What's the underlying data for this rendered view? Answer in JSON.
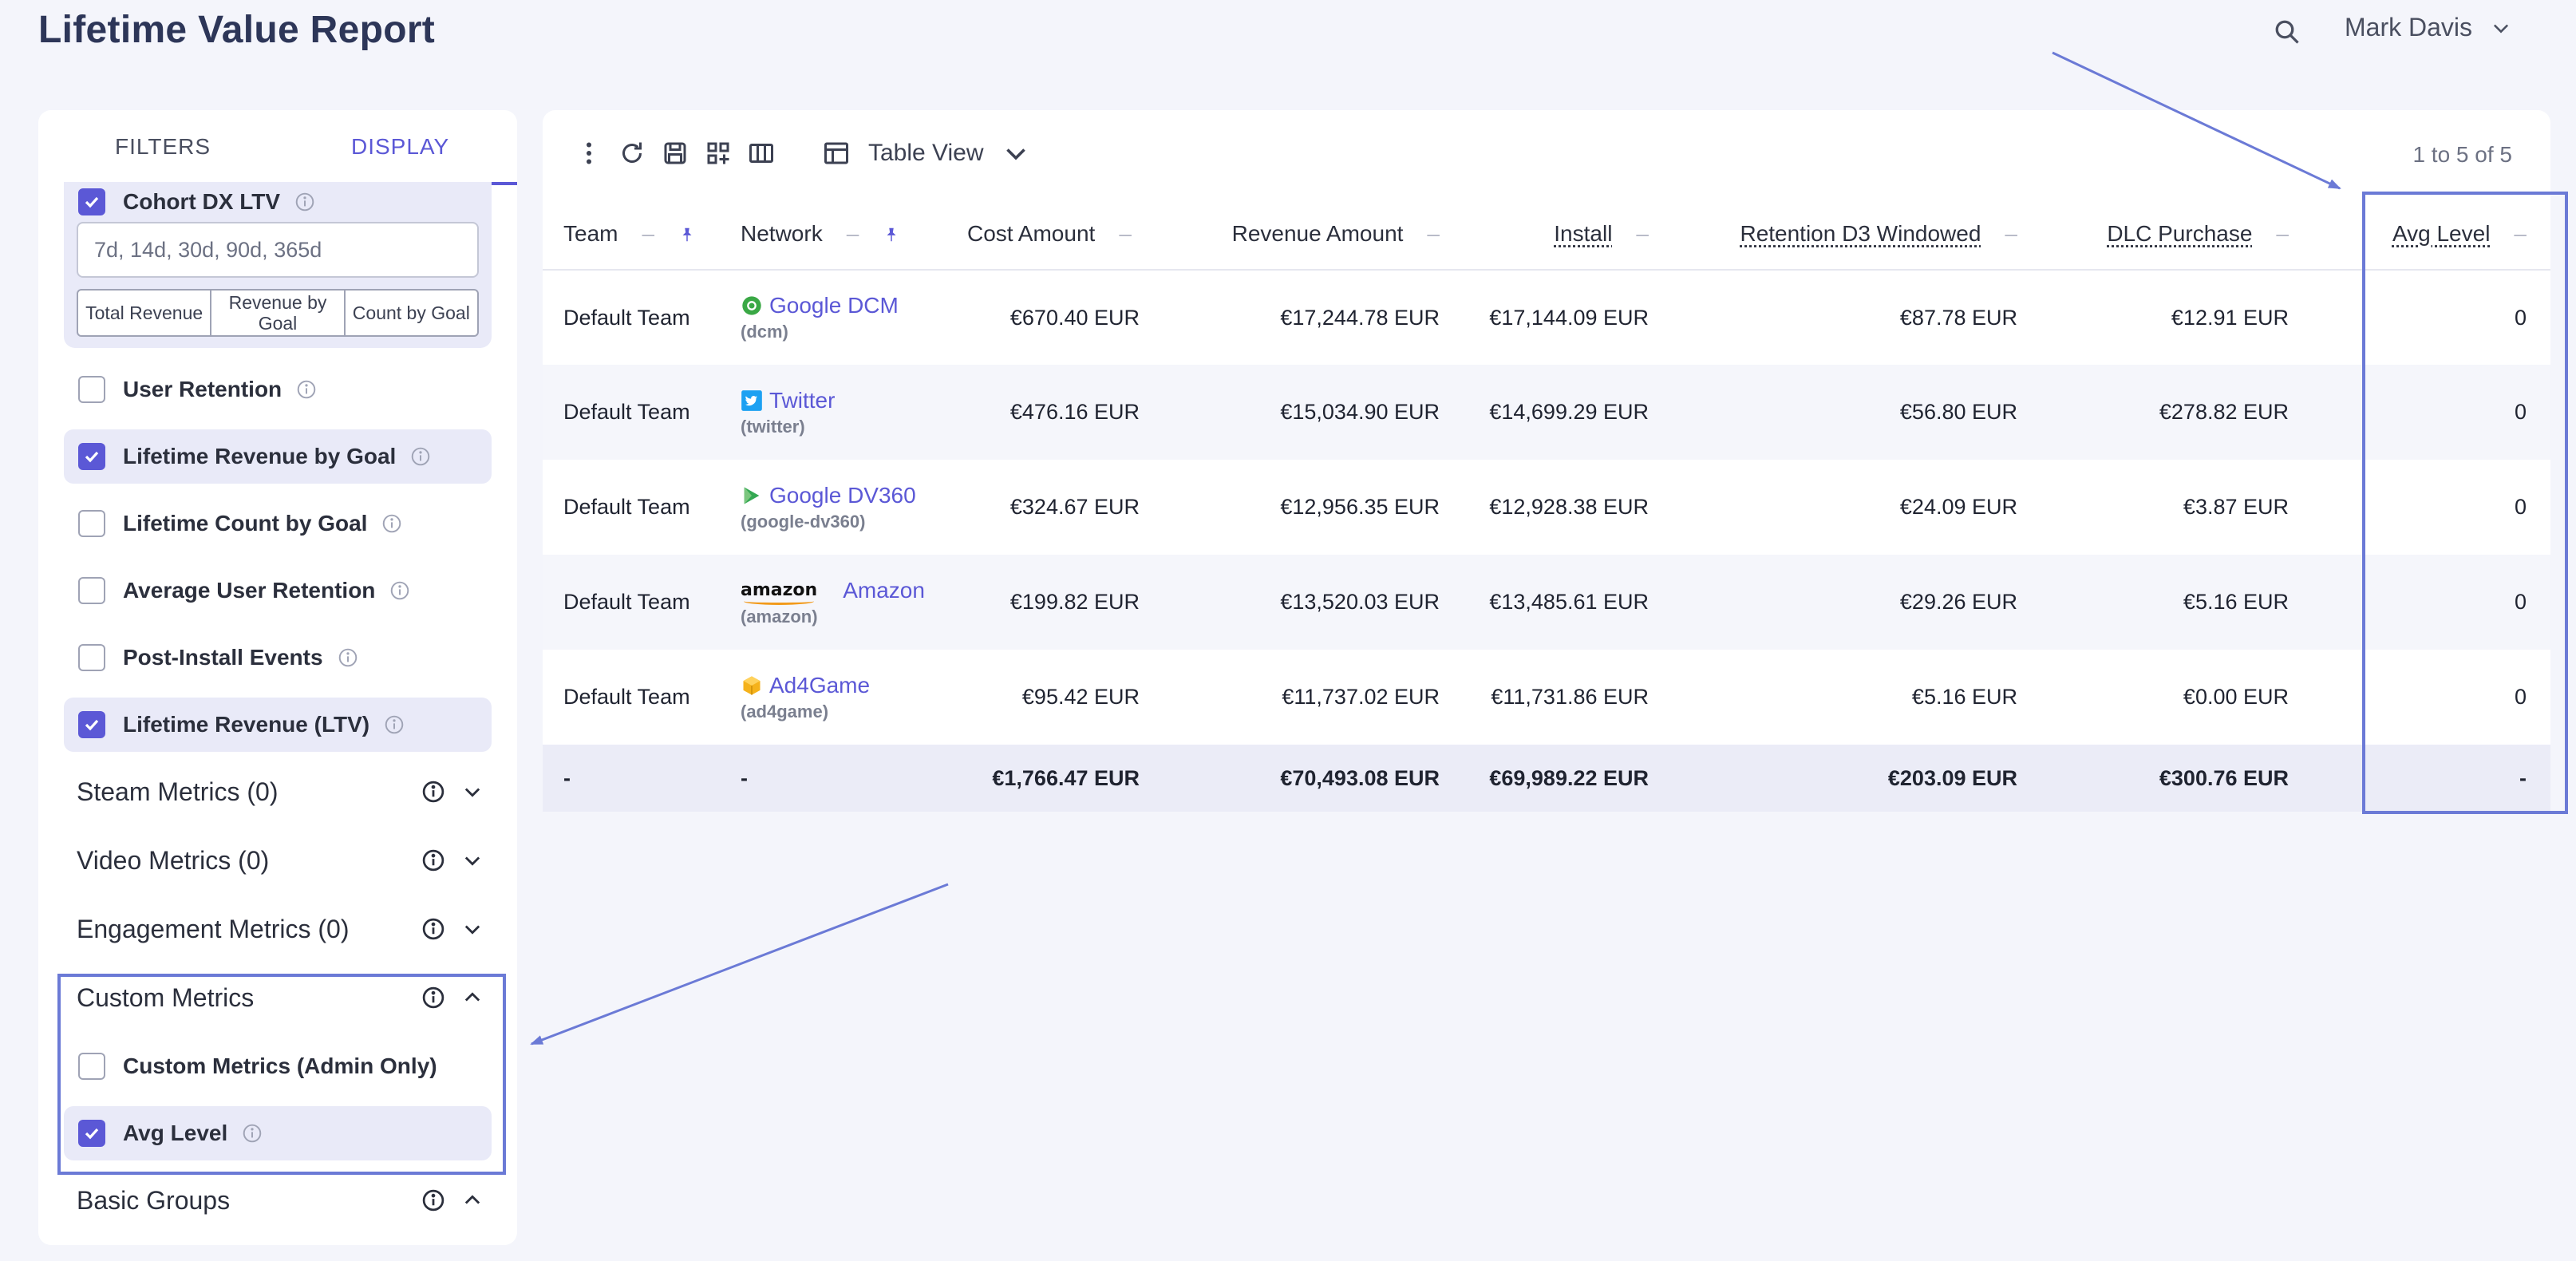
{
  "header": {
    "title": "Lifetime Value Report",
    "user_name": "Mark Davis"
  },
  "sidebar": {
    "tabs": {
      "filters": "FILTERS",
      "display": "DISPLAY"
    },
    "cohort": {
      "label": "Cohort DX LTV",
      "input_value": "7d, 14d, 30d, 90d, 365d",
      "goal_buttons": [
        "Total Revenue",
        "Revenue by Goal",
        "Count by Goal"
      ]
    },
    "items": [
      {
        "label": "User Retention",
        "checked": false
      },
      {
        "label": "Lifetime Revenue by Goal",
        "checked": true
      },
      {
        "label": "Lifetime Count by Goal",
        "checked": false
      },
      {
        "label": "Average User Retention",
        "checked": false
      },
      {
        "label": "Post-Install Events",
        "checked": false
      },
      {
        "label": "Lifetime Revenue (LTV)",
        "checked": true
      }
    ],
    "sections": {
      "steam": "Steam Metrics (0)",
      "video": "Video Metrics (0)",
      "engagement": "Engagement Metrics (0)",
      "custom": "Custom Metrics",
      "basic": "Basic Groups"
    },
    "custom_items": [
      {
        "label": "Custom Metrics (Admin Only)",
        "checked": false
      },
      {
        "label": "Avg Level",
        "checked": true
      }
    ]
  },
  "main": {
    "view_label": "Table View",
    "pagination": "1 to 5 of 5",
    "columns": [
      "Team",
      "Network",
      "Cost Amount",
      "Revenue Amount",
      "Install",
      "Retention D3 Windowed",
      "DLC Purchase",
      "Avg Level"
    ],
    "rows": [
      {
        "team": "Default Team",
        "network": "Google DCM",
        "network_id": "(dcm)",
        "cost": "€670.40 EUR",
        "revenue": "€17,244.78 EUR",
        "install": "€17,144.09 EUR",
        "retention": "€87.78 EUR",
        "dlc": "€12.91 EUR",
        "avg_level": "0"
      },
      {
        "team": "Default Team",
        "network": "Twitter",
        "network_id": "(twitter)",
        "cost": "€476.16 EUR",
        "revenue": "€15,034.90 EUR",
        "install": "€14,699.29 EUR",
        "retention": "€56.80 EUR",
        "dlc": "€278.82 EUR",
        "avg_level": "0"
      },
      {
        "team": "Default Team",
        "network": "Google DV360",
        "network_id": "(google-dv360)",
        "cost": "€324.67 EUR",
        "revenue": "€12,956.35 EUR",
        "install": "€12,928.38 EUR",
        "retention": "€24.09 EUR",
        "dlc": "€3.87 EUR",
        "avg_level": "0"
      },
      {
        "team": "Default Team",
        "network": "Amazon",
        "network_id": "(amazon)",
        "logo_text": "amazon",
        "cost": "€199.82 EUR",
        "revenue": "€13,520.03 EUR",
        "install": "€13,485.61 EUR",
        "retention": "€29.26 EUR",
        "dlc": "€5.16 EUR",
        "avg_level": "0"
      },
      {
        "team": "Default Team",
        "network": "Ad4Game",
        "network_id": "(ad4game)",
        "cost": "€95.42 EUR",
        "revenue": "€11,737.02 EUR",
        "install": "€11,731.86 EUR",
        "retention": "€5.16 EUR",
        "dlc": "€0.00 EUR",
        "avg_level": "0"
      }
    ],
    "totals": {
      "team": "-",
      "network": "-",
      "cost": "€1,766.47 EUR",
      "revenue": "€70,493.08 EUR",
      "install": "€69,989.22 EUR",
      "retention": "€203.09 EUR",
      "dlc": "€300.76 EUR",
      "avg_level": "-"
    }
  },
  "colors": {
    "accent": "#5b58d6",
    "annotation": "#6b7ad6"
  }
}
